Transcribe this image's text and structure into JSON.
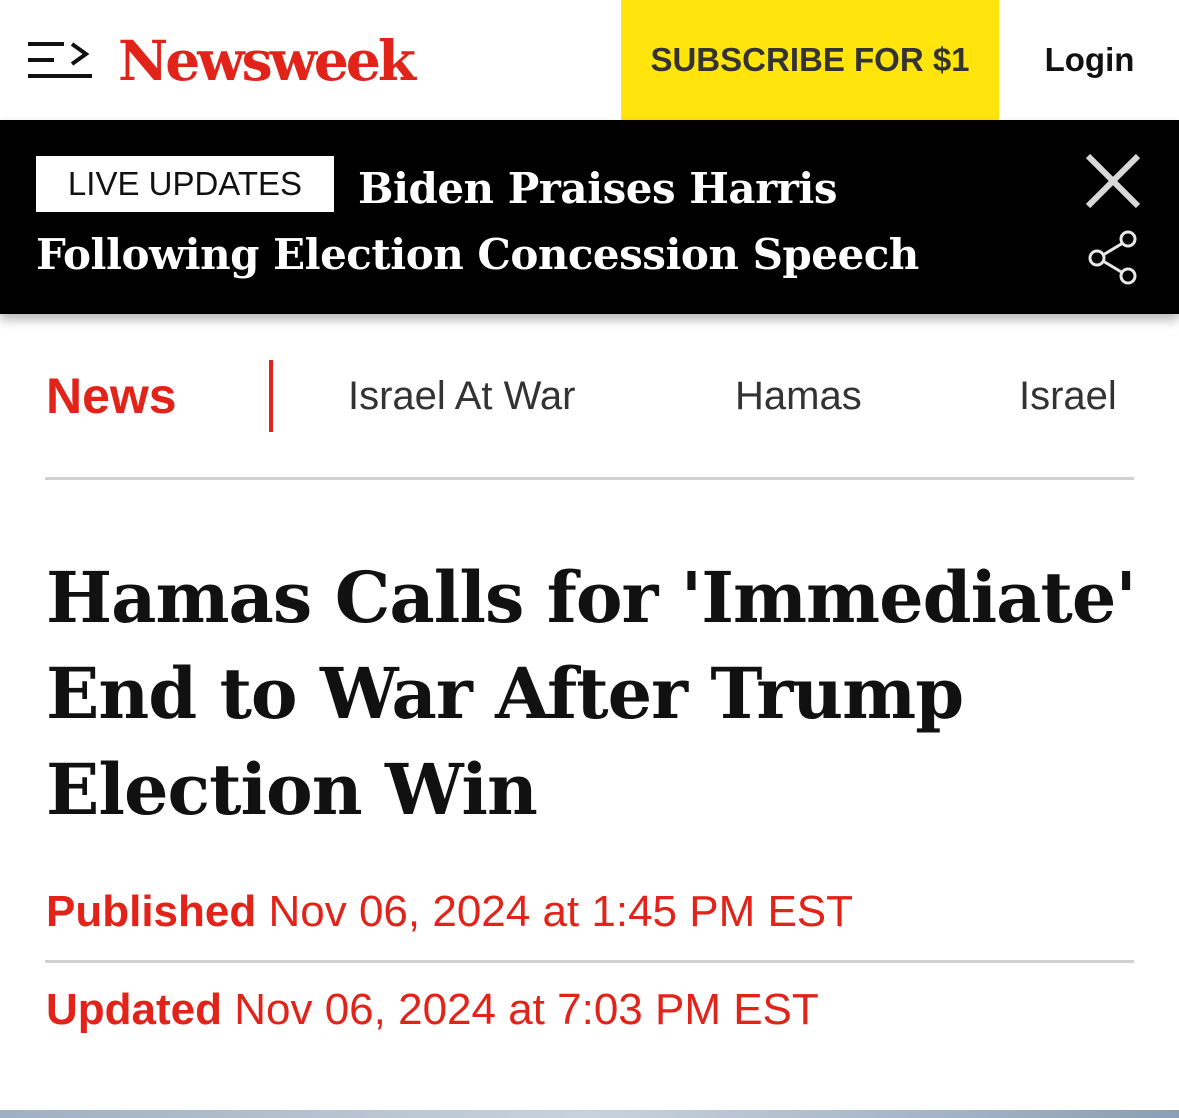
{
  "header": {
    "logo_text": "Newsweek",
    "subscribe_label": "SUBSCRIBE FOR $1",
    "login_label": "Login",
    "menu_icon": "menu-arrow-icon"
  },
  "live_banner": {
    "badge": "LIVE UPDATES",
    "headline": "Biden Praises Harris Following Election Concession Speech",
    "close_icon": "close-icon",
    "share_icon": "share-icon"
  },
  "category_nav": {
    "main": "News",
    "links": [
      "Israel At War",
      "Hamas",
      "Israel"
    ]
  },
  "article": {
    "headline": "Hamas Calls for 'Immediate' End to War After Trump Election Win",
    "published_label": "Published",
    "published_value": "Nov 06, 2024 at 1:45 PM EST",
    "updated_label": "Updated",
    "updated_value": "Nov 06, 2024 at 7:03 PM EST"
  },
  "colors": {
    "brand_red": "#e2231a",
    "subscribe_yellow": "#ffe50b",
    "banner_black": "#000000"
  }
}
